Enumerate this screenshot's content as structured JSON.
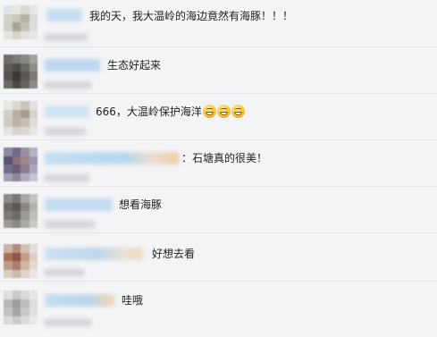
{
  "comments": [
    {
      "text": "我的天，我大温岭的海边竟然有海豚！！！",
      "emoji_count": 0
    },
    {
      "text": "生态好起来",
      "emoji_count": 0
    },
    {
      "text": "666，大温岭保护海洋",
      "emoji_count": 3,
      "emoji_icon": "grinning-face-icon"
    },
    {
      "text": "：石塘真的很美！",
      "emoji_count": 0
    },
    {
      "text": "想看海豚",
      "emoji_count": 0
    },
    {
      "text": "好想去看",
      "emoji_count": 0
    },
    {
      "text": "哇哦",
      "emoji_count": 0
    }
  ],
  "colors": {
    "background": "#f3f4f6",
    "text": "#222222",
    "divider": "#e2e3e6",
    "username_blur": "#b9d8f0"
  }
}
